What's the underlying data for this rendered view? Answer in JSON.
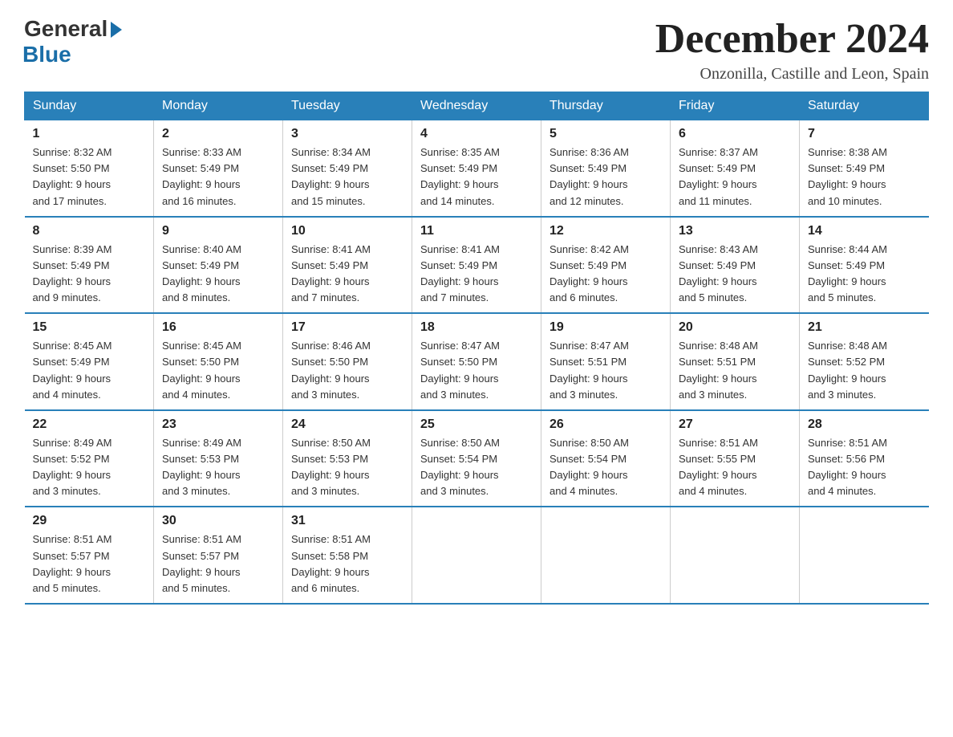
{
  "logo": {
    "general": "General",
    "blue": "Blue"
  },
  "title": "December 2024",
  "location": "Onzonilla, Castille and Leon, Spain",
  "days_of_week": [
    "Sunday",
    "Monday",
    "Tuesday",
    "Wednesday",
    "Thursday",
    "Friday",
    "Saturday"
  ],
  "weeks": [
    [
      {
        "day": "1",
        "sunrise": "8:32 AM",
        "sunset": "5:50 PM",
        "daylight": "9 hours and 17 minutes."
      },
      {
        "day": "2",
        "sunrise": "8:33 AM",
        "sunset": "5:49 PM",
        "daylight": "9 hours and 16 minutes."
      },
      {
        "day": "3",
        "sunrise": "8:34 AM",
        "sunset": "5:49 PM",
        "daylight": "9 hours and 15 minutes."
      },
      {
        "day": "4",
        "sunrise": "8:35 AM",
        "sunset": "5:49 PM",
        "daylight": "9 hours and 14 minutes."
      },
      {
        "day": "5",
        "sunrise": "8:36 AM",
        "sunset": "5:49 PM",
        "daylight": "9 hours and 12 minutes."
      },
      {
        "day": "6",
        "sunrise": "8:37 AM",
        "sunset": "5:49 PM",
        "daylight": "9 hours and 11 minutes."
      },
      {
        "day": "7",
        "sunrise": "8:38 AM",
        "sunset": "5:49 PM",
        "daylight": "9 hours and 10 minutes."
      }
    ],
    [
      {
        "day": "8",
        "sunrise": "8:39 AM",
        "sunset": "5:49 PM",
        "daylight": "9 hours and 9 minutes."
      },
      {
        "day": "9",
        "sunrise": "8:40 AM",
        "sunset": "5:49 PM",
        "daylight": "9 hours and 8 minutes."
      },
      {
        "day": "10",
        "sunrise": "8:41 AM",
        "sunset": "5:49 PM",
        "daylight": "9 hours and 7 minutes."
      },
      {
        "day": "11",
        "sunrise": "8:41 AM",
        "sunset": "5:49 PM",
        "daylight": "9 hours and 7 minutes."
      },
      {
        "day": "12",
        "sunrise": "8:42 AM",
        "sunset": "5:49 PM",
        "daylight": "9 hours and 6 minutes."
      },
      {
        "day": "13",
        "sunrise": "8:43 AM",
        "sunset": "5:49 PM",
        "daylight": "9 hours and 5 minutes."
      },
      {
        "day": "14",
        "sunrise": "8:44 AM",
        "sunset": "5:49 PM",
        "daylight": "9 hours and 5 minutes."
      }
    ],
    [
      {
        "day": "15",
        "sunrise": "8:45 AM",
        "sunset": "5:49 PM",
        "daylight": "9 hours and 4 minutes."
      },
      {
        "day": "16",
        "sunrise": "8:45 AM",
        "sunset": "5:50 PM",
        "daylight": "9 hours and 4 minutes."
      },
      {
        "day": "17",
        "sunrise": "8:46 AM",
        "sunset": "5:50 PM",
        "daylight": "9 hours and 3 minutes."
      },
      {
        "day": "18",
        "sunrise": "8:47 AM",
        "sunset": "5:50 PM",
        "daylight": "9 hours and 3 minutes."
      },
      {
        "day": "19",
        "sunrise": "8:47 AM",
        "sunset": "5:51 PM",
        "daylight": "9 hours and 3 minutes."
      },
      {
        "day": "20",
        "sunrise": "8:48 AM",
        "sunset": "5:51 PM",
        "daylight": "9 hours and 3 minutes."
      },
      {
        "day": "21",
        "sunrise": "8:48 AM",
        "sunset": "5:52 PM",
        "daylight": "9 hours and 3 minutes."
      }
    ],
    [
      {
        "day": "22",
        "sunrise": "8:49 AM",
        "sunset": "5:52 PM",
        "daylight": "9 hours and 3 minutes."
      },
      {
        "day": "23",
        "sunrise": "8:49 AM",
        "sunset": "5:53 PM",
        "daylight": "9 hours and 3 minutes."
      },
      {
        "day": "24",
        "sunrise": "8:50 AM",
        "sunset": "5:53 PM",
        "daylight": "9 hours and 3 minutes."
      },
      {
        "day": "25",
        "sunrise": "8:50 AM",
        "sunset": "5:54 PM",
        "daylight": "9 hours and 3 minutes."
      },
      {
        "day": "26",
        "sunrise": "8:50 AM",
        "sunset": "5:54 PM",
        "daylight": "9 hours and 4 minutes."
      },
      {
        "day": "27",
        "sunrise": "8:51 AM",
        "sunset": "5:55 PM",
        "daylight": "9 hours and 4 minutes."
      },
      {
        "day": "28",
        "sunrise": "8:51 AM",
        "sunset": "5:56 PM",
        "daylight": "9 hours and 4 minutes."
      }
    ],
    [
      {
        "day": "29",
        "sunrise": "8:51 AM",
        "sunset": "5:57 PM",
        "daylight": "9 hours and 5 minutes."
      },
      {
        "day": "30",
        "sunrise": "8:51 AM",
        "sunset": "5:57 PM",
        "daylight": "9 hours and 5 minutes."
      },
      {
        "day": "31",
        "sunrise": "8:51 AM",
        "sunset": "5:58 PM",
        "daylight": "9 hours and 6 minutes."
      },
      null,
      null,
      null,
      null
    ]
  ],
  "labels": {
    "sunrise": "Sunrise:",
    "sunset": "Sunset:",
    "daylight": "Daylight:"
  }
}
